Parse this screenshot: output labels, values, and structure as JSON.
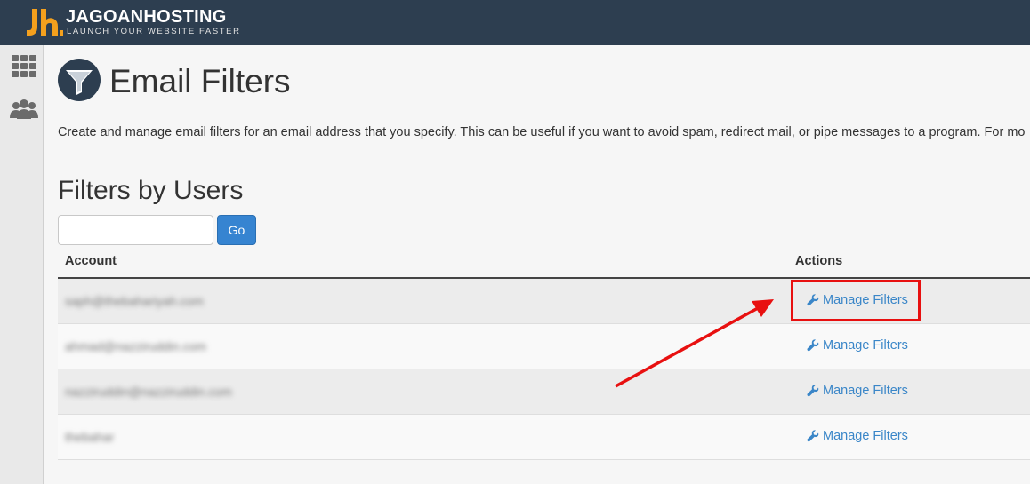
{
  "brand": {
    "name": "JAGOANHOSTING",
    "tagline": "LAUNCH YOUR WEBSITE FASTER",
    "colors": {
      "topbar": "#2d3e50",
      "logo_accent": "#f4a01d"
    }
  },
  "sidebar": {
    "items": [
      {
        "icon": "grid-icon"
      },
      {
        "icon": "users-icon"
      }
    ]
  },
  "page": {
    "icon": "filter-funnel-icon",
    "title": "Email Filters",
    "description": "Create and manage email filters for an email address that you specify. This can be useful if you want to avoid spam, redirect mail, or pipe messages to a program. For mo"
  },
  "section": {
    "title": "Filters by Users",
    "search": {
      "value": "",
      "placeholder": ""
    },
    "go_label": "Go"
  },
  "table": {
    "columns": [
      "Account",
      "Actions"
    ],
    "rows": [
      {
        "account": "saph@thebahariyah.com",
        "action": "Manage Filters"
      },
      {
        "account": "ahmad@nazziruddin.com",
        "action": "Manage Filters"
      },
      {
        "account": "nazziruddin@nazziruddin.com",
        "action": "Manage Filters"
      },
      {
        "account": "thebahar",
        "action": "Manage Filters"
      }
    ]
  },
  "annotation": {
    "color": "#e81010",
    "target": "first row Manage Filters"
  },
  "colors": {
    "accent": "#3684d1",
    "link": "#3a86c8"
  }
}
